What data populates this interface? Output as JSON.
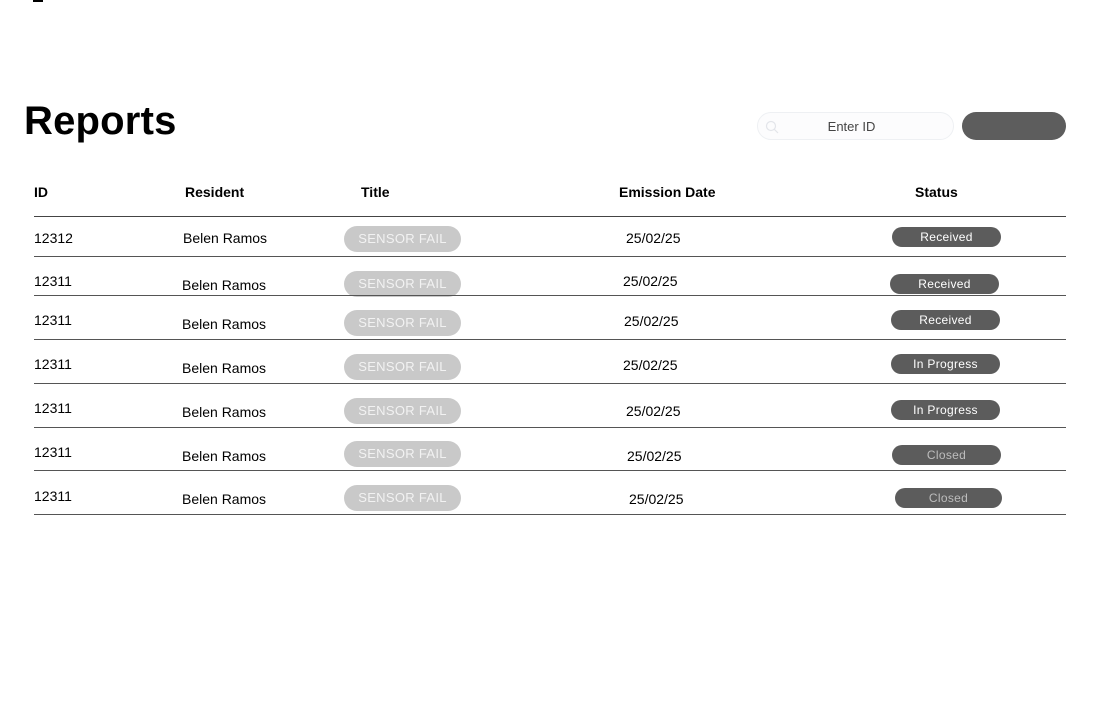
{
  "page": {
    "title": "Reports"
  },
  "search": {
    "placeholder": "Enter ID",
    "button_label": ""
  },
  "table": {
    "columns": [
      "ID",
      "Resident",
      "Title",
      "Emission Date",
      "Status"
    ],
    "rows": [
      {
        "id": "12312",
        "resident": "Belen Ramos",
        "title": "SENSOR FAIL",
        "date": "25/02/25",
        "status": "Received"
      },
      {
        "id": "12311",
        "resident": "Belen Ramos",
        "title": "SENSOR FAIL",
        "date": "25/02/25",
        "status": "Received"
      },
      {
        "id": "12311",
        "resident": "Belen Ramos",
        "title": "SENSOR FAIL",
        "date": "25/02/25",
        "status": "Received"
      },
      {
        "id": "12311",
        "resident": "Belen Ramos",
        "title": "SENSOR FAIL",
        "date": "25/02/25",
        "status": "In Progress"
      },
      {
        "id": "12311",
        "resident": "Belen Ramos",
        "title": "SENSOR FAIL",
        "date": "25/02/25",
        "status": "In Progress"
      },
      {
        "id": "12311",
        "resident": "Belen Ramos",
        "title": "SENSOR FAIL",
        "date": "25/02/25",
        "status": "Closed"
      },
      {
        "id": "12311",
        "resident": "Belen Ramos",
        "title": "SENSOR FAIL",
        "date": "25/02/25",
        "status": "Closed"
      }
    ]
  },
  "colors": {
    "title_pill": "#c9c9c9",
    "status_pill": "#5c5c5c",
    "search_button": "#5d5d5d"
  },
  "icons": {
    "search": "search-icon"
  }
}
